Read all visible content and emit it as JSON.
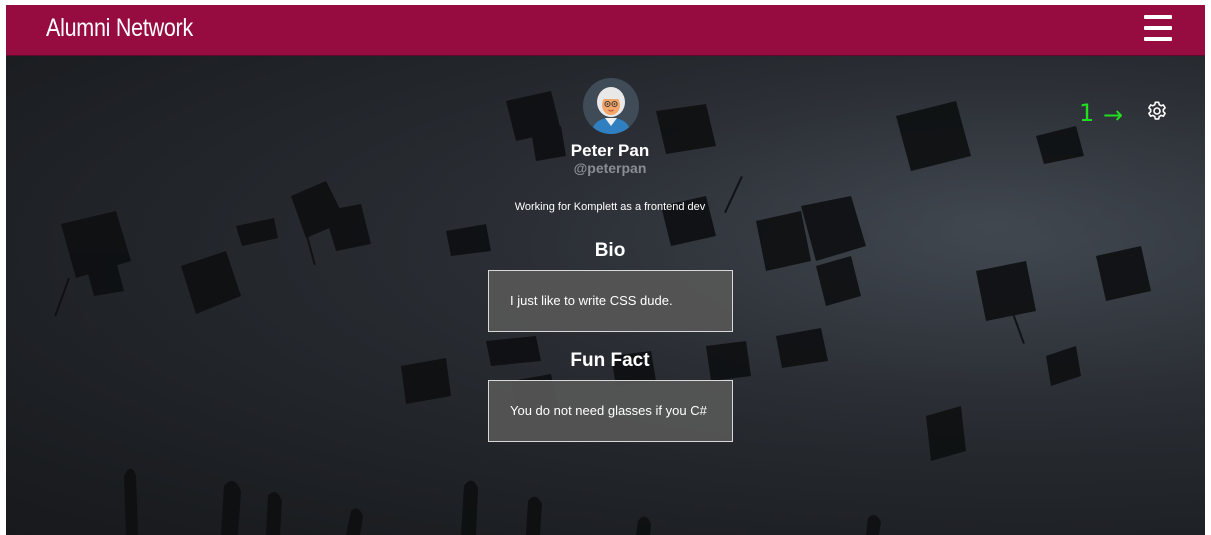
{
  "navbar": {
    "brand": "Alumni Network",
    "menu_icon": "hamburger-menu-icon",
    "color": "#970c40"
  },
  "notifications": {
    "count": "1",
    "arrow": "→",
    "color": "#22dd22",
    "settings_icon": "gear-icon"
  },
  "profile": {
    "name": "Peter Pan",
    "username": "@peterpan",
    "tagline": "Working for Komplett as a frontend dev",
    "avatar_icon": "avatar-icon"
  },
  "bio": {
    "heading": "Bio",
    "text": "I just like to write CSS dude."
  },
  "fun_fact": {
    "heading": "Fun Fact",
    "text": "You do not need glasses if you C#"
  }
}
